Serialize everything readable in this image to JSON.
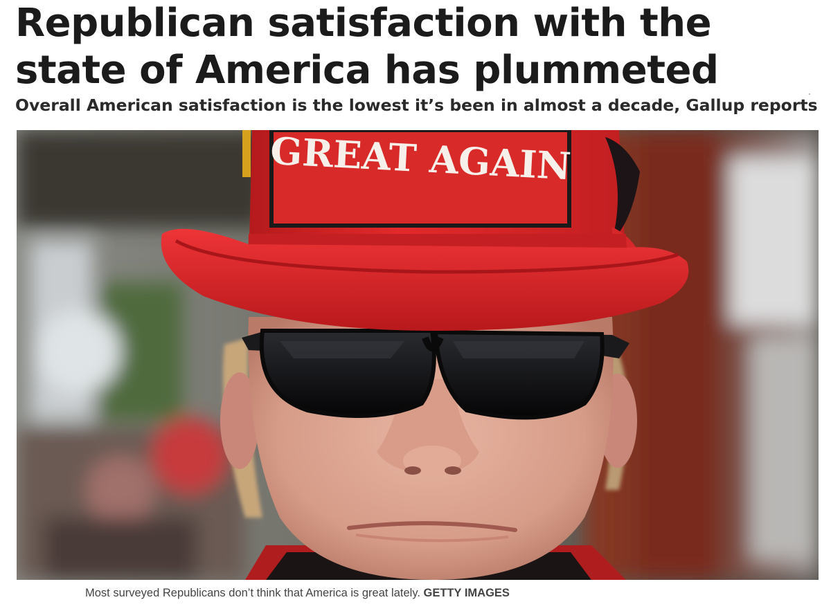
{
  "article": {
    "headline": "Republican satisfaction with the state of America has plummeted",
    "subheadline": "Overall American satisfaction is the lowest it’s been in almost a decade, Gallup reports"
  },
  "photo": {
    "hat_patch_text": "GREAT AGAIN",
    "colors": {
      "hat_red": "#e0282a",
      "patch_red": "#d92a2a",
      "lens_black": "#0d0d0f",
      "skin": "#d9a38f"
    }
  },
  "caption": {
    "text": "Most surveyed Republicans don’t think that America is great lately.",
    "credit": "GETTY IMAGES"
  }
}
